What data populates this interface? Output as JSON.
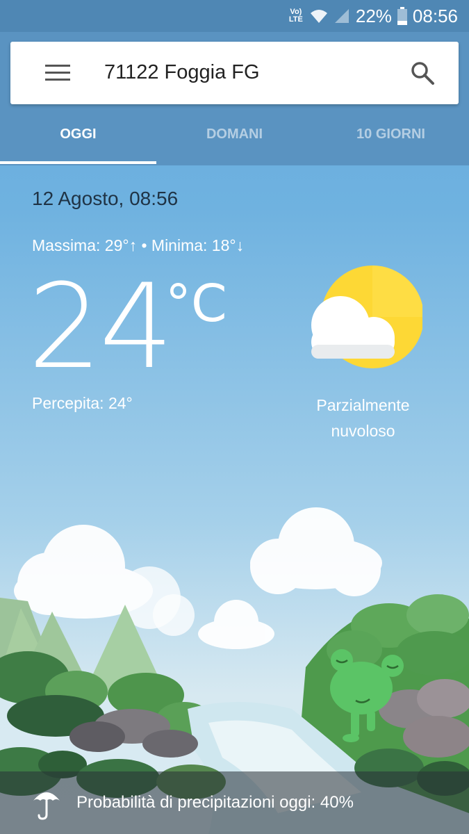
{
  "status_bar": {
    "network_label": "Vo) LTE",
    "battery": "22%",
    "time": "08:56"
  },
  "search": {
    "location": "71122 Foggia FG",
    "menu_icon": "hamburger-menu-icon",
    "search_icon": "search-icon"
  },
  "tabs": [
    {
      "label": "OGGI",
      "active": true
    },
    {
      "label": "DOMANI",
      "active": false
    },
    {
      "label": "10 GIORNI",
      "active": false
    }
  ],
  "weather": {
    "date_time": "12 Agosto, 08:56",
    "min_max": "Massima: 29°↑ • Minima: 18°↓",
    "temperature": "24",
    "unit": "°C",
    "feels_like": "Percepita: 24°",
    "condition_line1": "Parzialmente",
    "condition_line2": "nuvoloso",
    "condition_icon": "partly-cloudy-icon"
  },
  "precipitation": {
    "text": "Probabilità di precipitazioni oggi: 40%",
    "icon": "umbrella-icon"
  },
  "colors": {
    "header": "#5a93c1",
    "status_bar": "#4f87b4",
    "sky_top": "#63a9dc",
    "sun": "#fdd835"
  }
}
